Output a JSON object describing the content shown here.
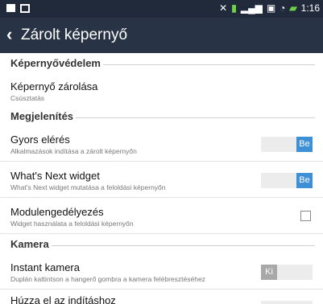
{
  "status_bar": {
    "time": "1:16"
  },
  "app_bar": {
    "back_icon": "chevron-left-icon",
    "title": "Zárolt képernyő"
  },
  "sections": [
    {
      "label": "Képernyővédelem"
    },
    {
      "label": "Megjelenítés"
    },
    {
      "label": "Kamera"
    }
  ],
  "items": [
    {
      "title": "Képernyő zárolása",
      "subtitle": "Csúsztatás"
    },
    {
      "title": "Gyors elérés",
      "subtitle": "Alkalmazások indítása a zárolt képernyőn",
      "toggle_label": "Be"
    },
    {
      "title": "What's Next widget",
      "subtitle": "What's Next widget mutatása a feloldási képernyőn",
      "toggle_label": "Be"
    },
    {
      "title": "Modulengedélyezés",
      "subtitle": "Widget használata a feloldási képernyőn",
      "checked": false
    },
    {
      "title": "Instant kamera",
      "subtitle": "Duplán kattintson a hangerő gombra a kamera felébresztéséhez",
      "toggle_label": "Ki"
    },
    {
      "title": "Húzza el az indításhoz"
    }
  ],
  "colors": {
    "status_bar": "#202a3a",
    "app_bar": "#283446",
    "toggle_on": "#3d8fd6",
    "toggle_off": "#a8a8a8"
  }
}
